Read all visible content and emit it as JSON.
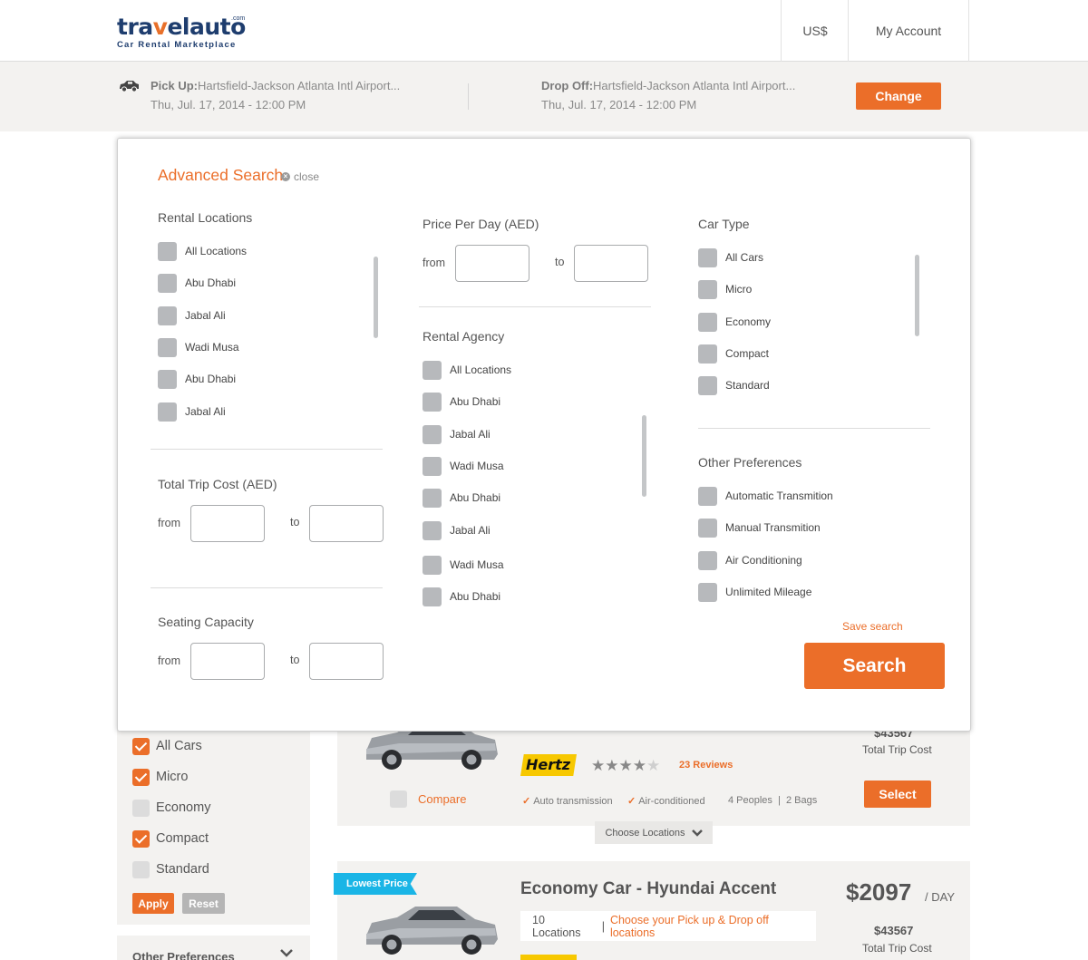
{
  "header": {
    "logo_text_a": "tra",
    "logo_text_v": "v",
    "logo_text_b": "elauto",
    "logo_com": ".com",
    "logo_sub": "Car Rental Marketplace",
    "currency": "US$",
    "account": "My Account"
  },
  "summary": {
    "pickup_label": "Pick Up:",
    "pickup_location": "Hartsfield-Jackson Atlanta Intl Airport...",
    "pickup_date": "Thu, Jul. 17, 2014 - 12:00 PM",
    "dropoff_label": "Drop Off:",
    "dropoff_location": "Hartsfield-Jackson Atlanta Intl Airport...",
    "dropoff_date": "Thu, Jul. 17, 2014 - 12:00 PM",
    "change_label": "Change"
  },
  "modal": {
    "title": "Advanced Search",
    "close_label": "close",
    "rental_locations": {
      "title": "Rental Locations",
      "options": [
        "All Locations",
        "Abu Dhabi",
        "Jabal Ali",
        "Wadi Musa",
        "Abu Dhabi",
        "Jabal Ali"
      ]
    },
    "total_trip_cost": {
      "title": "Total Trip Cost (AED)",
      "from": "from",
      "to": "to"
    },
    "seating_capacity": {
      "title": "Seating Capacity",
      "from": "from",
      "to": "to"
    },
    "price_per_day": {
      "title": "Price Per Day (AED)",
      "from": "from",
      "to": "to"
    },
    "rental_agency": {
      "title": "Rental Agency",
      "options": [
        "All Locations",
        "Abu Dhabi",
        "Jabal Ali",
        "Wadi Musa",
        "Abu Dhabi",
        "Jabal Ali",
        "Wadi Musa",
        "Abu Dhabi"
      ]
    },
    "car_type": {
      "title": "Car Type",
      "options": [
        "All Cars",
        "Micro",
        "Economy",
        "Compact",
        "Standard"
      ]
    },
    "other_preferences": {
      "title": "Other Preferences",
      "options": [
        "Automatic Transmition",
        "Manual Transmition",
        "Air Conditioning",
        "Unlimited Mileage"
      ]
    },
    "save_search": "Save search",
    "search_label": "Search"
  },
  "sidebar": {
    "car_types": [
      {
        "label": "All Cars",
        "checked": true
      },
      {
        "label": "Micro",
        "checked": true
      },
      {
        "label": "Economy",
        "checked": false
      },
      {
        "label": "Compact",
        "checked": true
      },
      {
        "label": "Standard",
        "checked": false
      }
    ],
    "apply_label": "Apply",
    "reset_label": "Reset",
    "other_preferences_label": "Other Preferences"
  },
  "listing1": {
    "agency": "Hertz",
    "rating_stars": 4,
    "reviews": "23 Reviews",
    "compare_label": "Compare",
    "features": [
      "Auto transmission",
      "Air-conditioned"
    ],
    "capacity": "4 Peoples  |  2 Bags",
    "total_price": "$43567",
    "total_label": "Total Trip Cost",
    "select_label": "Select",
    "choose_locations": "Choose Locations"
  },
  "listing2": {
    "badge": "Lowest Price",
    "title": "Economy Car - Hyundai Accent",
    "price": "$2097",
    "per_day": "/ DAY",
    "locations_count": "10 Locations",
    "locations_sep": "|",
    "locations_link": "Choose your Pick up & Drop off locations",
    "total_price": "$43567",
    "total_label": "Total Trip Cost"
  },
  "colors": {
    "accent": "#eb6e29",
    "brand_navy": "#1e3d6e",
    "ribbon": "#1ab5e6",
    "checkbox_idle": "#b7b9bc"
  }
}
